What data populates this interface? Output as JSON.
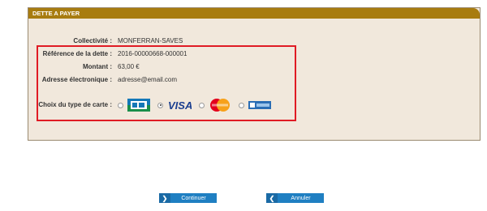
{
  "panel": {
    "title": "DETTE A PAYER",
    "fields": [
      {
        "label": "Collectivité :",
        "value": "MONFERRAN-SAVES"
      },
      {
        "label": "Référence de la dette :",
        "value": "2016-00000668-000001"
      },
      {
        "label": "Montant :",
        "value": "63,00 €"
      },
      {
        "label": "Adresse électronique :",
        "value": "adresse@email.com"
      }
    ],
    "card_choice_label": "Choix du type de carte :",
    "cards": [
      {
        "name": "CB",
        "selected": false
      },
      {
        "name": "VISA",
        "selected": true
      },
      {
        "name": "MasterCard",
        "selected": false
      },
      {
        "name": "e-Bleue",
        "selected": false
      }
    ]
  },
  "buttons": {
    "continue_label": "Continuer",
    "cancel_label": "Annuler"
  },
  "colors": {
    "header": "#a87c10",
    "panel_bg": "#f1e8dc",
    "highlight": "#e01b24",
    "button": "#1f7fc2"
  }
}
